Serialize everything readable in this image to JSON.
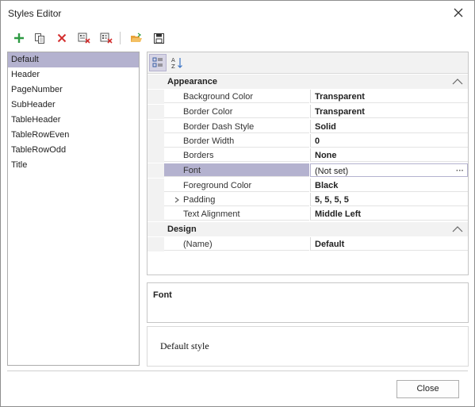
{
  "window": {
    "title": "Styles Editor"
  },
  "toolbar": {
    "buttons": [
      {
        "name": "add-style",
        "icon": "plus-icon",
        "color": "#2e9a43"
      },
      {
        "name": "copy-style",
        "icon": "copy-icon",
        "color": "#555555"
      },
      {
        "name": "delete-style",
        "icon": "delete-icon",
        "color": "#d32f2f"
      },
      {
        "name": "purge-style",
        "icon": "purge-icon",
        "color": "#d32f2f"
      },
      {
        "name": "clear-styles",
        "icon": "clear-icon",
        "color": "#d32f2f"
      },
      {
        "name": "load-styles",
        "icon": "open-folder-icon",
        "color": "#e8a23a"
      },
      {
        "name": "save-styles",
        "icon": "save-icon",
        "color": "#333333"
      }
    ]
  },
  "styles": {
    "selected": "Default",
    "items": [
      "Default",
      "Header",
      "PageNumber",
      "SubHeader",
      "TableHeader",
      "TableRowEven",
      "TableRowOdd",
      "Title"
    ]
  },
  "grid": {
    "categories": [
      {
        "label": "Appearance",
        "properties": [
          {
            "name": "Background Color",
            "value": "Transparent"
          },
          {
            "name": "Border Color",
            "value": "Transparent"
          },
          {
            "name": "Border Dash Style",
            "value": "Solid"
          },
          {
            "name": "Border Width",
            "value": "0"
          },
          {
            "name": "Borders",
            "value": "None"
          },
          {
            "name": "Font",
            "value": "(Not set)",
            "selected": true
          },
          {
            "name": "Foreground Color",
            "value": "Black"
          },
          {
            "name": "Padding",
            "value": "5, 5, 5, 5",
            "expandable": true
          },
          {
            "name": "Text Alignment",
            "value": "Middle Left"
          }
        ]
      },
      {
        "label": "Design",
        "properties": [
          {
            "name": "(Name)",
            "value": "Default"
          }
        ]
      }
    ],
    "ellipsis": "···"
  },
  "description": {
    "title": "Font"
  },
  "preview": {
    "text": "Default style"
  },
  "footer": {
    "close_label": "Close"
  },
  "colors": {
    "selection": "#b4b2cf",
    "category_bg": "#f2f2f2"
  }
}
